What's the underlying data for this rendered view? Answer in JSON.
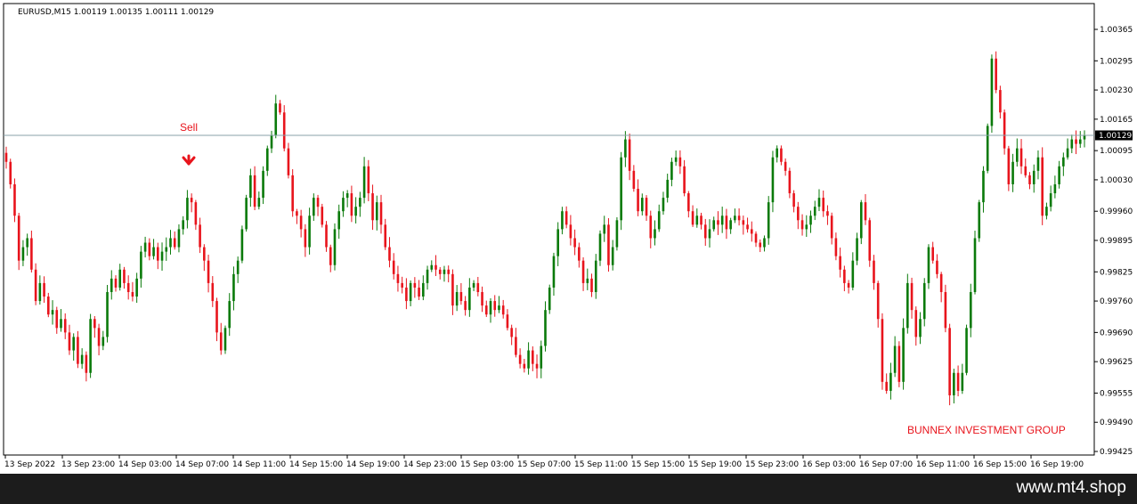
{
  "header": {
    "symbol_info": "EURUSD,M15  1.00119 1.00135 1.00111 1.00129"
  },
  "annotations": {
    "sell_label": "Sell",
    "sell_arrow_icon": "down-arrow-icon",
    "watermark": "BUNNEX INVESTMENT GROUP"
  },
  "footer": {
    "site": "www.mt4.shop"
  },
  "colors": {
    "bull": "#0a7a0a",
    "bear": "#e8141c",
    "accent": "#e8141c",
    "price_line": "#8aa0a8",
    "price_tag_bg": "#000000"
  },
  "chart_data": {
    "type": "candlestick",
    "symbol": "EURUSD",
    "timeframe": "M15",
    "current_price": "1.00129",
    "y_ticks": [
      "1.00365",
      "1.00295",
      "1.00230",
      "1.00165",
      "1.00095",
      "1.00030",
      "0.99960",
      "0.99895",
      "0.99825",
      "0.99760",
      "0.99690",
      "0.99625",
      "0.99555",
      "0.99490",
      "0.99425"
    ],
    "ylim": [
      0.9942,
      1.00375
    ],
    "x_ticks": [
      "13 Sep 2022",
      "13 Sep 23:00",
      "14 Sep 03:00",
      "14 Sep 07:00",
      "14 Sep 11:00",
      "14 Sep 15:00",
      "14 Sep 19:00",
      "14 Sep 23:00",
      "15 Sep 03:00",
      "15 Sep 07:00",
      "15 Sep 11:00",
      "15 Sep 15:00",
      "15 Sep 19:00",
      "15 Sep 23:00",
      "16 Sep 03:00",
      "16 Sep 07:00",
      "16 Sep 11:00",
      "16 Sep 15:00",
      "16 Sep 19:00"
    ],
    "sell_bar_index": 51,
    "closes": [
      1.0007,
      1.0002,
      0.9995,
      0.9985,
      0.9988,
      0.999,
      0.9983,
      0.9976,
      0.998,
      0.9977,
      0.9973,
      0.9974,
      0.997,
      0.9972,
      0.9969,
      0.9965,
      0.9968,
      0.9962,
      0.9964,
      0.996,
      0.9972,
      0.997,
      0.9966,
      0.9968,
      0.9978,
      0.9981,
      0.9979,
      0.9983,
      0.998,
      0.9978,
      0.9977,
      0.9981,
      0.9987,
      0.9989,
      0.9986,
      0.9988,
      0.9985,
      0.9987,
      0.9988,
      0.999,
      0.9988,
      0.9992,
      0.9994,
      0.9999,
      0.9998,
      0.9993,
      0.9988,
      0.9985,
      0.998,
      0.9976,
      0.9969,
      0.9965,
      0.997,
      0.9976,
      0.9982,
      0.9985,
      0.9992,
      0.9999,
      1.0004,
      0.9997,
      0.9999,
      1.0005,
      1.001,
      1.0013,
      1.002,
      1.0018,
      1.001,
      1.0004,
      0.9996,
      0.9995,
      0.9992,
      0.9988,
      0.9995,
      0.9999,
      0.9997,
      0.9993,
      0.9988,
      0.9984,
      0.9992,
      0.9996,
      0.9999,
      1.0,
      0.9995,
      0.9997,
      0.9999,
      1.0006,
      1.0,
      0.9994,
      0.9998,
      0.9993,
      0.9988,
      0.9985,
      0.9982,
      0.998,
      0.9979,
      0.9976,
      0.998,
      0.9979,
      0.9977,
      0.998,
      0.9983,
      0.9984,
      0.9983,
      0.9982,
      0.9983,
      0.9982,
      0.9975,
      0.9978,
      0.9976,
      0.9974,
      0.9979,
      0.998,
      0.9978,
      0.9975,
      0.9973,
      0.9976,
      0.9974,
      0.9975,
      0.9973,
      0.997,
      0.9968,
      0.9964,
      0.9962,
      0.9961,
      0.9965,
      0.9962,
      0.9961,
      0.9966,
      0.9974,
      0.9979,
      0.9986,
      0.9992,
      0.9996,
      0.9993,
      0.999,
      0.9988,
      0.9985,
      0.998,
      0.9981,
      0.9978,
      0.9985,
      0.9991,
      0.9993,
      0.9984,
      0.9988,
      0.9994,
      1.0008,
      1.0012,
      1.0005,
      1.0001,
      0.9996,
      0.9999,
      0.9995,
      0.999,
      0.9992,
      0.9996,
      0.9999,
      1.0003,
      1.0007,
      1.0008,
      1.0006,
      1.0,
      0.9996,
      0.9993,
      0.9995,
      0.9993,
      0.999,
      0.9992,
      0.9994,
      0.9993,
      0.9995,
      0.9992,
      0.9994,
      0.9995,
      0.9994,
      0.9993,
      0.9992,
      0.9991,
      0.9989,
      0.9988,
      0.999,
      0.9998,
      1.0008,
      1.001,
      1.0007,
      1.0005,
      1.0,
      0.9997,
      0.9994,
      0.9992,
      0.9993,
      0.9995,
      0.9997,
      0.9999,
      0.9996,
      0.9995,
      0.999,
      0.9986,
      0.9983,
      0.998,
      0.9979,
      0.9985,
      0.999,
      0.9998,
      0.9994,
      0.9985,
      0.998,
      0.9972,
      0.9958,
      0.9956,
      0.996,
      0.9966,
      0.9958,
      0.997,
      0.998,
      0.9974,
      0.9968,
      0.9972,
      0.998,
      0.9988,
      0.9985,
      0.9982,
      0.9978,
      0.997,
      0.9955,
      0.996,
      0.9956,
      0.996,
      0.997,
      0.9978,
      0.999,
      0.9998,
      1.0005,
      1.0015,
      1.003,
      1.0023,
      1.0018,
      1.001,
      1.0002,
      1.0007,
      1.001,
      1.0006,
      1.0004,
      1.0002,
      1.0005,
      1.0008,
      0.9995,
      0.9997,
      1.0,
      1.0002,
      1.0006,
      1.0008,
      1.001,
      1.0012,
      1.0011,
      1.0012,
      1.00129
    ]
  }
}
